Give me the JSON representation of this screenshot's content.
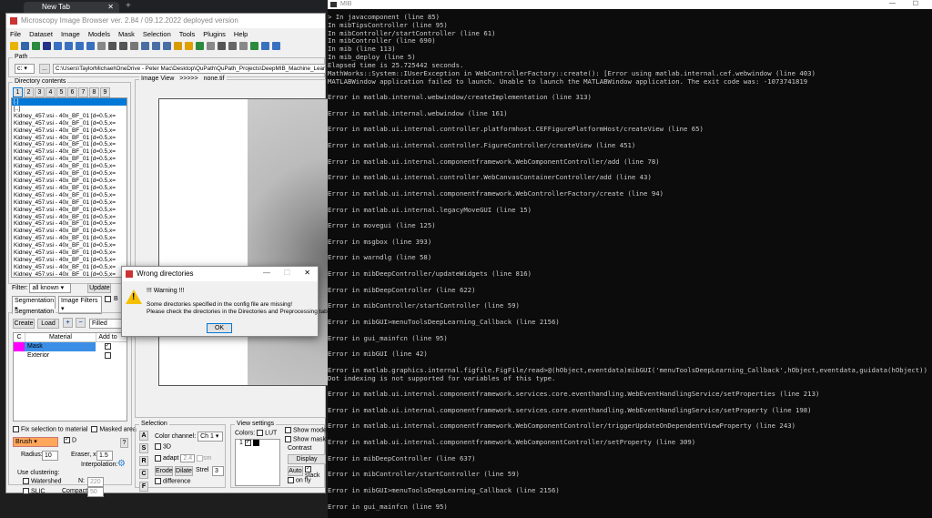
{
  "browser": {
    "tab_title": "New Tab",
    "new_tab": "+"
  },
  "mib": {
    "title": "Microscopy Image Browser ver. 2.84 / 09.12.2022 deployed version",
    "menu": [
      "File",
      "Dataset",
      "Image",
      "Models",
      "Mask",
      "Selection",
      "Tools",
      "Plugins",
      "Help"
    ],
    "path_label": "Path",
    "drive": "c:",
    "browse": "...",
    "path_value": "C:\\Users\\TaylorMichael\\OneDrive - Peter Mac\\Desktop\\QuPath\\QuPath_Projects\\DeepMIB_Machine_Learning\\Trained",
    "dir_title": "Directory contents",
    "dir_tabs": [
      "1",
      "2",
      "3",
      "4",
      "5",
      "6",
      "7",
      "8",
      "9"
    ],
    "dir_items": [
      "[.]",
      "[..]",
      "Kidney_457.vsi - 40x_BF_01 [d=0.5,x=",
      "Kidney_457.vsi - 40x_BF_01 [d=0.5,x=",
      "Kidney_457.vsi - 40x_BF_01 [d=0.5,x=",
      "Kidney_457.vsi - 40x_BF_01 [d=0.5,x=",
      "Kidney_457.vsi - 40x_BF_01 [d=0.5,x=",
      "Kidney_457.vsi - 40x_BF_01 [d=0.5,x=",
      "Kidney_457.vsi - 40x_BF_01 [d=0.5,x=",
      "Kidney_457.vsi - 40x_BF_01 [d=0.5,x=",
      "Kidney_457.vsi - 40x_BF_01 [d=0.5,x=",
      "Kidney_457.vsi - 40x_BF_01 [d=0.5,x=",
      "Kidney_457.vsi - 40x_BF_01 [d=0.5,x=",
      "Kidney_457.vsi - 40x_BF_01 [d=0.5,x=",
      "Kidney_457.vsi - 40x_BF_01 [d=0.5,x=",
      "Kidney_457.vsi - 40x_BF_01 [d=0.5,x=",
      "Kidney_457.vsi - 40x_BF_01 [d=0.5,x=",
      "Kidney_457.vsi - 40x_BF_01 [d=0.5,x=",
      "Kidney_457.vsi - 40x_BF_01 [d=0.5,x=",
      "Kidney_457.vsi - 40x_BF_01 [d=0.5,x=",
      "Kidney_457.vsi - 40x_BF_01 [d=0.5,x=",
      "Kidney_457.vsi - 40x_BF_01 [d=0.5,x=",
      "Kidney_457.vsi - 40x_BF_01 [d=0.5,x=",
      "Kidney_457.vsi - 40x_BF_01 [d=0.5,x=",
      "Kidney_457.vsi - 40x_BF_01 [d=0.5,x="
    ],
    "filter_label": "Filter:",
    "filter_value": "all known",
    "update": "Update",
    "panel_select": "Segmentation",
    "image_filters": "Image Filters",
    "b_label": "B",
    "seg_title": "Segmentation",
    "create": "Create",
    "load": "Load",
    "plus": "+",
    "minus": "−",
    "fill_mode": "Filled",
    "mat_cols": [
      "C",
      "Material",
      "Add to"
    ],
    "materials": [
      {
        "name": "Mask",
        "color": "#ff00ff"
      },
      {
        "name": "Exterior",
        "color": "#ffffff"
      }
    ],
    "fix_selection": "Fix selection to material",
    "masked_area": "Masked area",
    "tool": "Brush",
    "d_label": "D",
    "help": "?",
    "radius_label": "Radius:",
    "radius": "10",
    "eraser_label": "Eraser, x:",
    "eraser": "1.5",
    "interp_label": "Interpolation:",
    "clustering": "Use clustering:",
    "watershed": "Watershed",
    "slic": "SLIC",
    "n_label": "N:",
    "n": "220",
    "compact_label": "Compact:",
    "compact": "50",
    "image_view": "Image View",
    "arrows": ">>>>>",
    "image_name": "none.tif",
    "sel_title": "Selection",
    "sel_buttons": [
      "A",
      "S",
      "R",
      "C",
      "F"
    ],
    "color_channel": "Color channel:",
    "channel": "Ch 1",
    "three_d": "3D",
    "adapt": "adapt",
    "adapt_val": "2.4",
    "sm": "sm",
    "erode": "Erode",
    "dilate": "Dilate",
    "strel": "Strel",
    "strel_val": "3",
    "difference": "difference",
    "view_title": "View settings",
    "colors": "Colors:",
    "lut": "LUT",
    "channel_num": "1",
    "show_model": "Show model",
    "show_mask": "Show mask",
    "contrast": "Contrast",
    "display": "Display",
    "auto": "Auto",
    "stack": "stack",
    "onfly": "on fly"
  },
  "dialog": {
    "title": "Wrong directories",
    "heading": "!!! Warning !!!",
    "line1": "Some directories specified in the config file are missing!",
    "line2": "Please check the directories in the Directories and Preprocessing tab",
    "ok": "OK"
  },
  "console": {
    "title": "MIB",
    "lines": [
      "> In javacomponent (line 85)",
      "In mibTipsController (line 95)",
      "In mibController/startController (line 61)",
      "In mibController (line 690)",
      "In mib (line 113)",
      "In mib_deploy (line 5)",
      "Elapsed time is 25.725442 seconds.",
      "MathWorks::System::IUserException in WebControllerFactory::create(): [Error using matlab.internal.cef.webwindow (line 403)",
      "MATLABWindow application failed to launch. Unable to launch the MATLABWindow application. The exit code was: -1073741819",
      "",
      "Error in matlab.internal.webwindow/createImplementation (line 313)",
      "",
      "Error in matlab.internal.webwindow (line 161)",
      "",
      "Error in matlab.ui.internal.controller.platformhost.CEFFigurePlatformHost/createView (line 65)",
      "",
      "Error in matlab.ui.internal.controller.FigureController/createView (line 451)",
      "",
      "Error in matlab.ui.internal.componentframework.WebComponentController/add (line 78)",
      "",
      "Error in matlab.ui.internal.controller.WebCanvasContainerController/add (line 43)",
      "",
      "Error in matlab.ui.internal.componentframework.WebControllerFactory/create (line 94)",
      "",
      "Error in matlab.ui.internal.legacyMoveGUI (line 15)",
      "",
      "Error in movegui (line 125)",
      "",
      "Error in msgbox (line 393)",
      "",
      "Error in warndlg (line 58)",
      "",
      "Error in mibDeepController/updateWidgets (line 816)",
      "",
      "Error in mibDeepController (line 622)",
      "",
      "Error in mibController/startController (line 59)",
      "",
      "Error in mibGUI>menuToolsDeepLearning_Callback (line 2156)",
      "",
      "Error in gui_mainfcn (line 95)",
      "",
      "Error in mibGUI (line 42)",
      "",
      "Error in matlab.graphics.internal.figfile.FigFile/read>@(hObject,eventdata)mibGUI('menuToolsDeepLearning_Callback',hObject,eventdata,guidata(hObject))",
      "Dot indexing is not supported for variables of this type.",
      "",
      "Error in matlab.ui.internal.componentframework.services.core.eventhandling.WebEventHandlingService/setProperties (line 213)",
      "",
      "Error in matlab.ui.internal.componentframework.services.core.eventhandling.WebEventHandlingService/setProperty (line 198)",
      "",
      "Error in matlab.ui.internal.componentframework.WebComponentController/triggerUpdateOnDependentViewProperty (line 243)",
      "",
      "Error in matlab.ui.internal.componentframework.WebComponentController/setProperty (line 309)",
      "",
      "Error in mibDeepController (line 637)",
      "",
      "Error in mibController/startController (line 59)",
      "",
      "Error in mibGUI>menuToolsDeepLearning_Callback (line 2156)",
      "",
      "Error in gui_mainfcn (line 95)"
    ]
  }
}
